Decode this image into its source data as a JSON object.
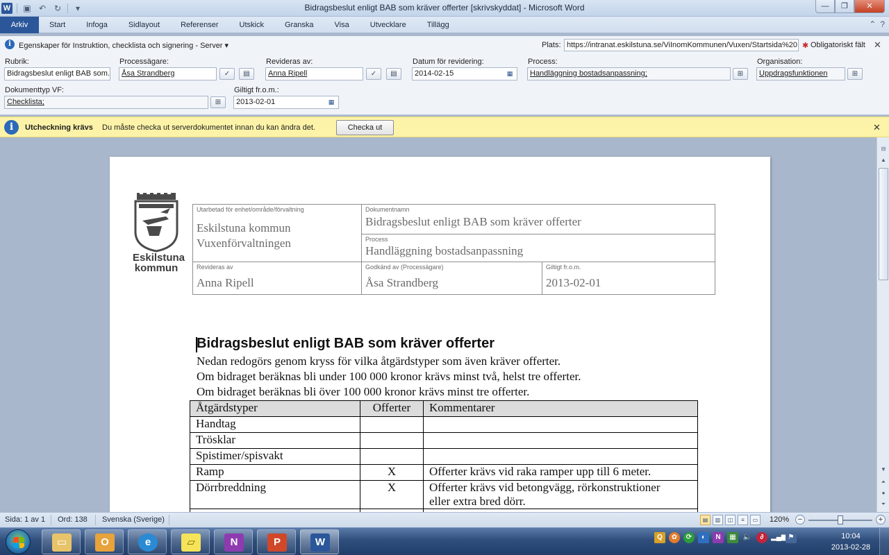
{
  "window": {
    "title": "Bidragsbeslut enligt BAB som kräver offerter [skrivskyddat] - Microsoft Word"
  },
  "ribbon": {
    "file_tab": "Arkiv",
    "tabs": [
      "Start",
      "Infoga",
      "Sidlayout",
      "Referenser",
      "Utskick",
      "Granska",
      "Visa",
      "Utvecklare",
      "Tillägg"
    ]
  },
  "properties": {
    "header_title": "Egenskaper för Instruktion, checklista och signering - Server",
    "plats_label": "Plats:",
    "plats_value": "https://intranat.eskilstuna.se/ViInomKommunen/Vuxen/Startsida%20",
    "required_note": "Obligatoriskt fält",
    "fields": {
      "rubrik_label": "Rubrik:",
      "rubrik_value": "Bidragsbeslut enligt BAB som...",
      "processagare_label": "Processägare:",
      "processagare_value": "Åsa Strandberg",
      "revideras_label": "Revideras av:",
      "revideras_value": "Anna Ripell",
      "datum_label": "Datum för revidering:",
      "datum_value": "2014-02-15",
      "process_label": "Process:",
      "process_value": "Handläggning bostadsanpassning;",
      "organisation_label": "Organisation:",
      "organisation_value": "Uppdragsfunktionen",
      "dokumenttyp_label": "Dokumenttyp VF:",
      "dokumenttyp_value": "Checklista;",
      "giltigt_label": "Giltigt fr.o.m.:",
      "giltigt_value": "2013-02-01"
    }
  },
  "message_bar": {
    "title": "Utcheckning krävs",
    "text": "Du måste checka ut serverdokumentet innan du kan ändra det.",
    "button": "Checka ut"
  },
  "document": {
    "logo_line1": "Eskilstuna",
    "logo_line2": "kommun",
    "header_table": {
      "cap_unit": "Utarbetad för enhet/område/förvaltning",
      "unit_line1": "Eskilstuna kommun",
      "unit_line2": "Vuxenförvaltningen",
      "cap_docname": "Dokumentnamn",
      "docname": "Bidragsbeslut enligt BAB som kräver offerter",
      "cap_process": "Process",
      "process": "Handläggning bostadsanpassning",
      "cap_revised": "Revideras av",
      "revised": "Anna Ripell",
      "cap_approved": "Godkänd av (Processägare)",
      "approved": "Åsa Strandberg",
      "cap_valid": "Giltigt fr.o.m.",
      "valid": "2013-02-01"
    },
    "heading": "Bidragsbeslut enligt BAB som kräver offerter",
    "paragraphs": [
      "Nedan redogörs genom kryss för vilka åtgärdstyper som även kräver offerter.",
      "Om bidraget beräknas bli under 100 000 kronor krävs minst två, helst tre offerter.",
      "Om bidraget beräknas bli över 100 000 kronor krävs minst tre offerter."
    ],
    "table": {
      "headers": [
        "Åtgärdstyper",
        "Offerter",
        "Kommentarer"
      ],
      "rows": [
        [
          "Handtag",
          "",
          ""
        ],
        [
          "Trösklar",
          "",
          ""
        ],
        [
          "Spistimer/spisvakt",
          "",
          ""
        ],
        [
          "Ramp",
          "X",
          "Offerter krävs vid raka ramper upp till 6 meter."
        ],
        [
          "Dörrbreddning",
          "X",
          "Offerter krävs vid betongvägg, rörkonstruktioner"
        ]
      ],
      "row5_comment_line2": "eller extra bred dörr."
    }
  },
  "status": {
    "page": "Sida: 1 av 1",
    "words": "Ord: 138",
    "language": "Svenska (Sverige)",
    "zoom": "120%",
    "zoom_fraction": 0.5
  },
  "taskbar": {
    "time": "10:04",
    "date": "2013-02-28",
    "icons": [
      "start-orb",
      "explorer-icon",
      "outlook-icon",
      "internet-explorer-icon",
      "sticky-notes-icon",
      "onenote-icon",
      "powerpoint-icon",
      "word-icon"
    ]
  },
  "colors": {
    "word_blue": "#2b579a",
    "message_bar": "#fcf3a8",
    "taskbar": "#2f4e7c"
  }
}
